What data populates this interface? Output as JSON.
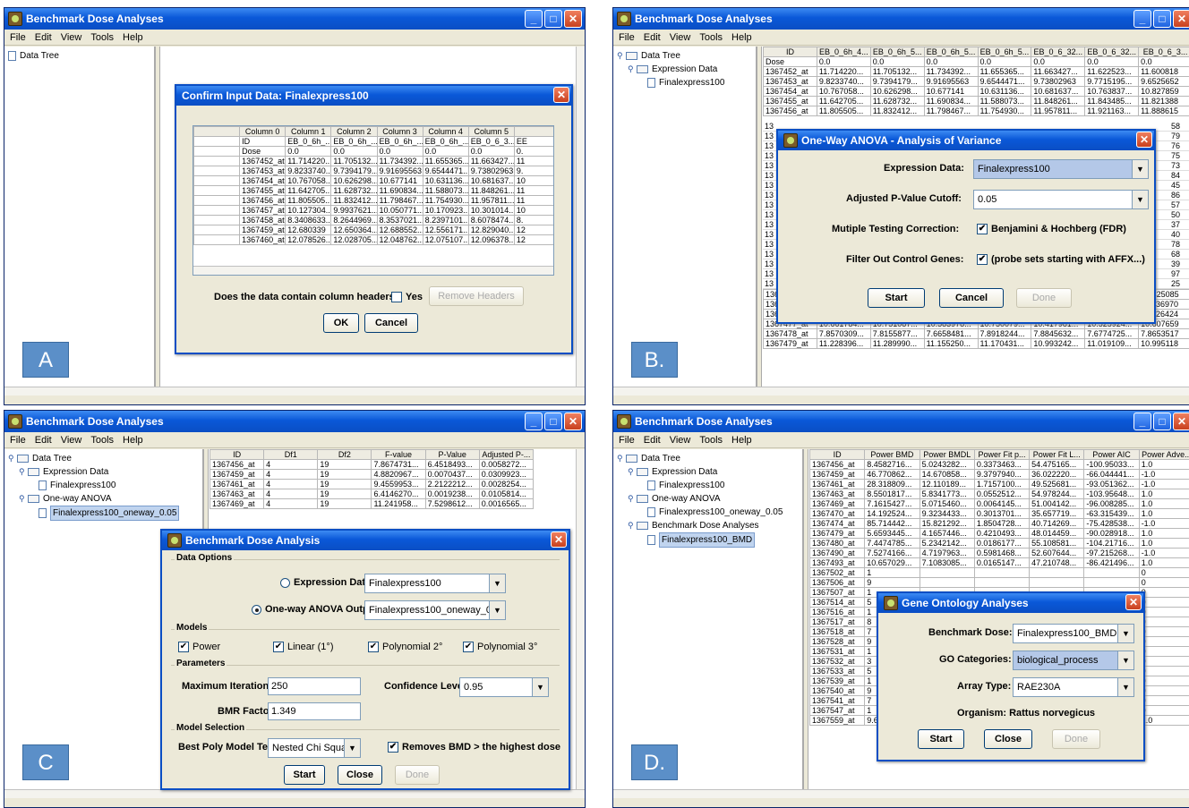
{
  "app_title": "Benchmark Dose Analyses",
  "menu": [
    "File",
    "Edit",
    "View",
    "Tools",
    "Help"
  ],
  "panels": {
    "A": {
      "tree": [
        "Data Tree"
      ],
      "label": "A",
      "dialog": {
        "title": "Confirm Input Data: Finalexpress100",
        "columns": [
          "",
          "Column 0",
          "Column 1",
          "Column 2",
          "Column 3",
          "Column 4",
          "Column 5",
          ""
        ],
        "rows": [
          [
            "",
            "ID",
            "EB_0_6h_...",
            "EB_0_6h_...",
            "EB_0_6h_...",
            "EB_0_6h_...",
            "EB_0_6_3...",
            "EE"
          ],
          [
            "",
            "Dose",
            "0.0",
            "0.0",
            "0.0",
            "0.0",
            "0.0",
            "0."
          ],
          [
            "",
            "1367452_at",
            "11.714220...",
            "11.705132...",
            "11.734392...",
            "11.655365...",
            "11.663427...",
            "11"
          ],
          [
            "",
            "1367453_at",
            "9.8233740...",
            "9.7394179...",
            "9.91695563",
            "9.6544471...",
            "9.73802963",
            "9."
          ],
          [
            "",
            "1367454_at",
            "10.767058...",
            "10.626298...",
            "10.677141",
            "10.631136...",
            "10.681637...",
            "10"
          ],
          [
            "",
            "1367455_at",
            "11.642705...",
            "11.628732...",
            "11.690834...",
            "11.588073...",
            "11.848261...",
            "11"
          ],
          [
            "",
            "1367456_at",
            "11.805505...",
            "11.832412...",
            "11.798467...",
            "11.754930...",
            "11.957811...",
            "11"
          ],
          [
            "",
            "1367457_at",
            "10.127304...",
            "9.9937621...",
            "10.050771...",
            "10.170923...",
            "10.301014...",
            "10"
          ],
          [
            "",
            "1367458_at",
            "8.3408633...",
            "8.2644969...",
            "8.3537021...",
            "8.2397101...",
            "8.6078474...",
            "8."
          ],
          [
            "",
            "1367459_at",
            "12.680339",
            "12.650364...",
            "12.688552...",
            "12.556171...",
            "12.829040...",
            "12"
          ],
          [
            "",
            "1367460_at",
            "12.078526...",
            "12.028705...",
            "12.048762...",
            "12.075107...",
            "12.096378...",
            "12"
          ]
        ],
        "question": "Does the data contain column headers?",
        "yes": "Yes",
        "remove": "Remove Headers",
        "ok": "OK",
        "cancel": "Cancel"
      }
    },
    "B": {
      "tree": [
        "Data Tree",
        "Expression Data",
        "Finalexpress100"
      ],
      "label": "B.",
      "columns": [
        "ID",
        "EB_0_6h_4...",
        "EB_0_6h_5...",
        "EB_0_6h_5...",
        "EB_0_6h_5...",
        "EB_0_6_32...",
        "EB_0_6_32...",
        "EB_0_6_3..."
      ],
      "rows": [
        [
          "Dose",
          "0.0",
          "0.0",
          "0.0",
          "0.0",
          "0.0",
          "0.0",
          "0.0"
        ],
        [
          "1367452_at",
          "11.714220...",
          "11.705132...",
          "11.734392...",
          "11.655365...",
          "11.663427...",
          "11.622523...",
          "11.600818"
        ],
        [
          "1367453_at",
          "9.8233740...",
          "9.7394179...",
          "9.91695563",
          "9.6544471...",
          "9.73802963",
          "9.7715195...",
          "9.6525652"
        ],
        [
          "1367454_at",
          "10.767058...",
          "10.626298...",
          "10.677141",
          "10.631136...",
          "10.681637...",
          "10.763837...",
          "10.827859"
        ],
        [
          "1367455_at",
          "11.642705...",
          "11.628732...",
          "11.690834...",
          "11.588073...",
          "11.848261...",
          "11.843485...",
          "11.821388"
        ],
        [
          "1367456_at",
          "11.805505...",
          "11.832412...",
          "11.798467...",
          "11.754930...",
          "11.957811...",
          "11.921163...",
          "11.888615"
        ]
      ],
      "rows_bottom": [
        [
          "1367474_at",
          "9.1199534...",
          "9.0341151...",
          "9.0919110...",
          "8.9828350...",
          "9.1628065...",
          "9.1194191...",
          "9.0425085"
        ],
        [
          "1367475_at",
          "11.4579025",
          "11.308543...",
          "11.367610...",
          "11.385789...",
          "11.536437...",
          "11.337794...",
          "11.336970"
        ],
        [
          "1367476_at",
          "12.023497...",
          "11.930513...",
          "11.896782...",
          "12.019692...",
          "11.918344...",
          "11.822670...",
          "11.926424"
        ],
        [
          "1367477_at",
          "10.661784...",
          "10.751087...",
          "10.583978...",
          "10.750079...",
          "10.417981...",
          "10.525924...",
          "10.607659"
        ],
        [
          "1367478_at",
          "7.8570309...",
          "7.8155877...",
          "7.6658481...",
          "7.8918244...",
          "7.8845632...",
          "7.6774725...",
          "7.8653517"
        ],
        [
          "1367479_at",
          "11.228396...",
          "11.289990...",
          "11.155250...",
          "11.170431...",
          "10.993242...",
          "11.019109...",
          "10.995118"
        ]
      ],
      "side_left": [
        "13",
        "13",
        "13",
        "13",
        "13",
        "13",
        "13",
        "13",
        "13",
        "13",
        "13",
        "13",
        "13",
        "13",
        "13",
        "13",
        "13"
      ],
      "side_right": [
        "58",
        "79",
        "76",
        "75",
        "73",
        "84",
        "45",
        "86",
        "57",
        "50",
        "37",
        "40",
        "78",
        "68",
        "39",
        "97",
        "25"
      ],
      "dialog": {
        "title": "One-Way ANOVA - Analysis of Variance",
        "expr_label": "Expression Data:",
        "expr_value": "Finalexpress100",
        "pval_label": "Adjusted P-Value Cutoff:",
        "pval_value": "0.05",
        "mtc_label": "Mutiple Testing Correction:",
        "mtc_value": "Benjamini & Hochberg (FDR)",
        "filter_label": "Filter Out Control Genes:",
        "filter_value": "(probe sets starting with AFFX...)",
        "start": "Start",
        "cancel": "Cancel",
        "done": "Done"
      }
    },
    "C": {
      "tree": [
        "Data Tree",
        "Expression Data",
        "Finalexpress100",
        "One-way ANOVA",
        "Finalexpress100_oneway_0.05"
      ],
      "label": "C",
      "columns": [
        "ID",
        "Df1",
        "Df2",
        "F-value",
        "P-Value",
        "Adjusted P-..."
      ],
      "rows": [
        [
          "1367456_at",
          "4",
          "19",
          "7.8674731...",
          "6.4518493...",
          "0.0058272..."
        ],
        [
          "1367459_at",
          "4",
          "19",
          "4.8820967...",
          "0.0070437...",
          "0.0309923..."
        ],
        [
          "1367461_at",
          "4",
          "19",
          "9.4559953...",
          "2.2122212...",
          "0.0028254..."
        ],
        [
          "1367463_at",
          "4",
          "19",
          "6.4146270...",
          "0.0019238...",
          "0.0105814..."
        ],
        [
          "1367469_at",
          "4",
          "19",
          "11.241958...",
          "7.5298612...",
          "0.0016565..."
        ]
      ],
      "dialog": {
        "title": "Benchmark Dose Analysis",
        "g_data": "Data Options",
        "expr_label": "Expression Data:",
        "expr_value": "Finalexpress100",
        "anova_label": "One-way ANOVA Output:",
        "anova_value": "Finalexpress100_oneway_0.05",
        "g_models": "Models",
        "m1": "Power",
        "m2": "Linear (1°)",
        "m3": "Polynomial 2°",
        "m4": "Polynomial 3°",
        "g_params": "Parameters",
        "iter_label": "Maximum Iterations:",
        "iter_value": "250",
        "conf_label": "Confidence Level:",
        "conf_value": "0.95",
        "bmr_label": "BMR Factor:",
        "bmr_value": "1.349",
        "g_sel": "Model Selection",
        "poly_label": "Best Poly Model Test:",
        "poly_value": "Nested Chi Square",
        "remove_label": "Removes BMD  > the highest dose",
        "start": "Start",
        "close": "Close",
        "done": "Done"
      }
    },
    "D": {
      "tree": [
        "Data Tree",
        "Expression Data",
        "Finalexpress100",
        "One-way ANOVA",
        "Finalexpress100_oneway_0.05",
        "Benchmark Dose Analyses",
        "Finalexpress100_BMD"
      ],
      "label": "D.",
      "columns": [
        "ID",
        "Power BMD",
        "Power BMDL",
        "Power Fit p...",
        "Power Fit L...",
        "Power AIC",
        "Power Adve..."
      ],
      "rows": [
        [
          "1367456_at",
          "8.4582716...",
          "5.0243282...",
          "0.3373463...",
          "54.475165...",
          "-100.95033...",
          "1.0"
        ],
        [
          "1367459_at",
          "46.770862...",
          "14.670858...",
          "9.3797940...",
          "36.022220...",
          "-66.044441...",
          "-1.0"
        ],
        [
          "1367461_at",
          "28.318809...",
          "12.110189...",
          "1.7157100...",
          "49.525681...",
          "-93.051362...",
          "-1.0"
        ],
        [
          "1367463_at",
          "8.5501817...",
          "5.8341773...",
          "0.0552512...",
          "54.978244...",
          "-103.95648...",
          "1.0"
        ],
        [
          "1367469_at",
          "7.1615427...",
          "5.0715460...",
          "0.0064145...",
          "51.004142...",
          "-96.008285...",
          "1.0"
        ],
        [
          "1367470_at",
          "14.192524...",
          "9.3234433...",
          "0.3013701...",
          "35.657719...",
          "-63.315439...",
          "1.0"
        ],
        [
          "1367474_at",
          "85.714442...",
          "15.821292...",
          "1.8504728...",
          "40.714269...",
          "-75.428538...",
          "-1.0"
        ],
        [
          "1367479_at",
          "5.6593445...",
          "4.1657446...",
          "0.4210493...",
          "48.014459...",
          "-90.028918...",
          "1.0"
        ],
        [
          "1367480_at",
          "7.4474785...",
          "5.2342142...",
          "0.0186177...",
          "55.108581...",
          "-104.21716...",
          "1.0"
        ],
        [
          "1367490_at",
          "7.5274166...",
          "4.7197963...",
          "0.5981468...",
          "52.607644...",
          "-97.215268...",
          "-1.0"
        ],
        [
          "1367493_at",
          "10.657029...",
          "7.1083085...",
          "0.0165147...",
          "47.210748...",
          "-86.421496...",
          "1.0"
        ],
        [
          "1367502_at",
          "1",
          "",
          "",
          "",
          "",
          "0"
        ],
        [
          "1367506_at",
          "9",
          "",
          "",
          "",
          "",
          "0"
        ],
        [
          "1367507_at",
          "1",
          "",
          "",
          "",
          "",
          "0"
        ],
        [
          "1367514_at",
          "5",
          "",
          "",
          "",
          "",
          "0"
        ],
        [
          "1367516_at",
          "1",
          "",
          "",
          "",
          "",
          "0"
        ],
        [
          "1367517_at",
          "8",
          "",
          "",
          "",
          "",
          "0"
        ],
        [
          "1367518_at",
          "7",
          "",
          "",
          "",
          "",
          "0"
        ],
        [
          "1367528_at",
          "9",
          "",
          "",
          "",
          "",
          "0"
        ],
        [
          "1367531_at",
          "1",
          "",
          "",
          "",
          "",
          "0"
        ],
        [
          "1367532_at",
          "3",
          "",
          "",
          "",
          "",
          "0"
        ],
        [
          "1367533_at",
          "5",
          "",
          "",
          "",
          "",
          "0"
        ],
        [
          "1367539_at",
          "1",
          "",
          "",
          "",
          "",
          "0"
        ],
        [
          "1367540_at",
          "9",
          "",
          "",
          "",
          "",
          "0"
        ],
        [
          "1367541_at",
          "7",
          "",
          "",
          "",
          "",
          "0"
        ],
        [
          "1367547_at",
          "1",
          "",
          "",
          "",
          "",
          "0"
        ],
        [
          "1367559_at",
          "9.6509108...",
          "6.3923682...",
          "0.1233037...",
          "28.271554...",
          "-50.543108...",
          "1.0"
        ]
      ],
      "dialog": {
        "title": "Gene Ontology Analyses",
        "bd_label": "Benchmark Dose:",
        "bd_value": "Finalexpress100_BMD",
        "go_label": "GO Categories:",
        "go_value": "biological_process",
        "arr_label": "Array Type:",
        "arr_value": "RAE230A",
        "org_label": "Organism:",
        "org_value": "Rattus norvegicus",
        "start": "Start",
        "close": "Close",
        "done": "Done"
      }
    }
  },
  "colors": {
    "title_blue": "#0a58d8",
    "label_blue": "#5b8fc8",
    "panel": "#ece9d8"
  }
}
